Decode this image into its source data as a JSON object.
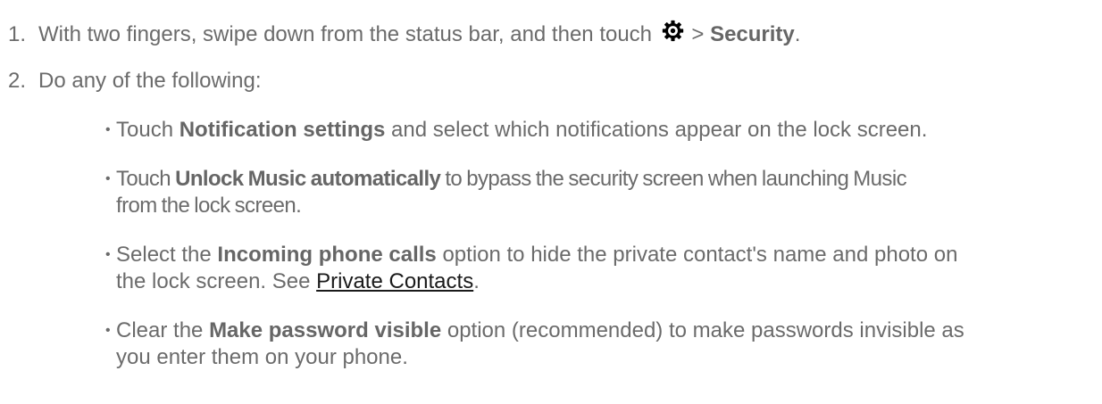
{
  "steps": [
    {
      "number": "1.",
      "text_before": "With two fingers, swipe down from the status bar, and then touch",
      "icon": "settings-gear-icon",
      "text_sep": " > ",
      "bold": "Security",
      "text_after": "."
    },
    {
      "number": "2.",
      "text": "Do any of the following:"
    }
  ],
  "bullets": [
    {
      "pre": "Touch ",
      "bold": "Notification settings",
      "post": " and select which notifications appear on the lock screen."
    },
    {
      "pre": "Touch ",
      "bold": "Unlock Music automatically",
      "post": " to bypass the security screen when launching Music",
      "line2": "from the lock screen."
    },
    {
      "pre": "Select the ",
      "bold": "Incoming phone calls",
      "post": " option to hide the private contact's name and photo on",
      "line2_pre": "the lock screen. See ",
      "link": "Private Contacts",
      "line2_post": "."
    },
    {
      "pre": "Clear the ",
      "bold": "Make password visible",
      "post": " option (recommended) to make passwords invisible as",
      "line2": "you enter them on your phone."
    }
  ],
  "bullet_glyph": "•"
}
